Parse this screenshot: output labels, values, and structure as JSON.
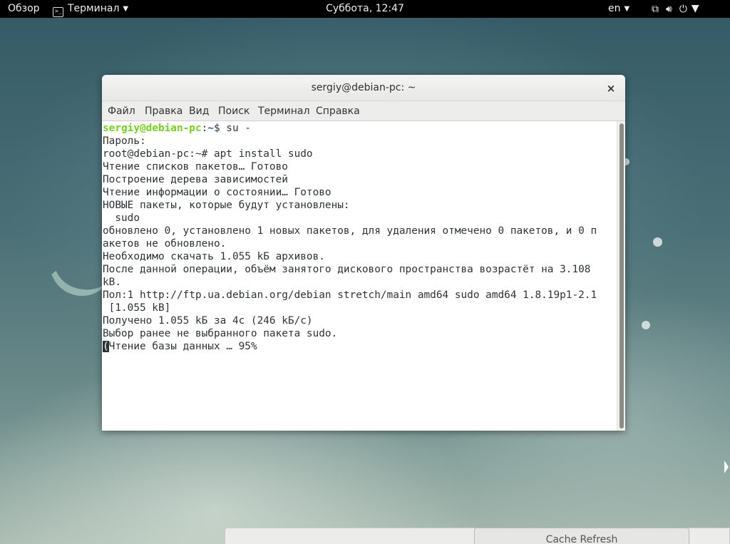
{
  "topbar": {
    "activities": "Обзор",
    "app_name": "Терминал",
    "clock": "Суббота, 12:47",
    "language": "en"
  },
  "icons": {
    "terminal": "terminal-icon",
    "network": "network-icon",
    "volume": "volume-icon",
    "power": "power-icon",
    "close": "close-icon"
  },
  "window": {
    "title": "sergiy@debian-pc: ~",
    "close": "×",
    "menu": [
      "Файл",
      "Правка",
      "Вид",
      "Поиск",
      "Терминал",
      "Справка"
    ]
  },
  "terminal": {
    "prompt_user": "sergiy@debian-pc",
    "prompt_sep": ":",
    "prompt_dir": "~",
    "prompt_cmd": "$ su -",
    "lines": [
      "Пароль:",
      "root@debian-pc:~# apt install sudo",
      "Чтение списков пакетов… Готово",
      "Построение дерева зависимостей",
      "Чтение информации о состоянии… Готово",
      "НОВЫЕ пакеты, которые будут установлены:",
      "  sudo",
      "обновлено 0, установлено 1 новых пакетов, для удаления отмечено 0 пакетов, и 0 п",
      "акетов не обновлено.",
      "Необходимо скачать 1.055 kБ архивов.",
      "После данной операции, объём занятого дискового пространства возрастёт на 3.108",
      "kB.",
      "Пол:1 http://ftp.ua.debian.org/debian stretch/main amd64 sudo amd64 1.8.19p1-2.1",
      " [1.055 kB]",
      "Получено 1.055 kБ за 4с (246 kБ/с)",
      "Выбор ранее не выбранного пакета sudo."
    ],
    "cursor_char": "(",
    "last_line_rest": "Чтение базы данных … 95%"
  },
  "bottom": {
    "cache_refresh": "Cache Refresh"
  }
}
